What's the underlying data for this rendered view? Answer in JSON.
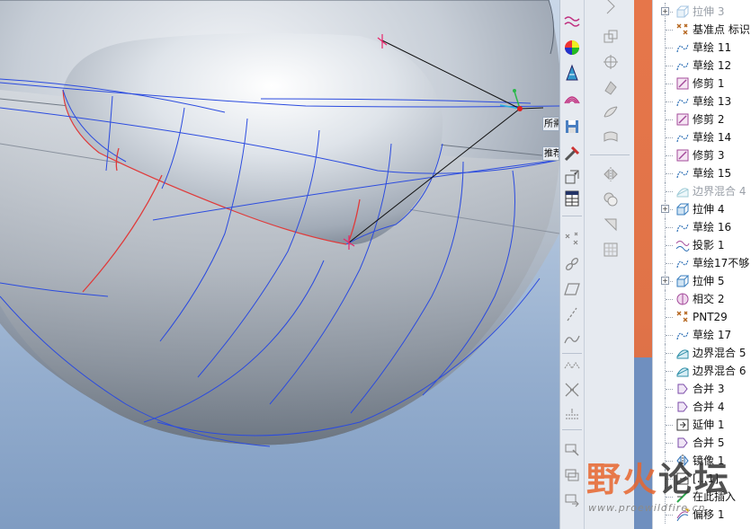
{
  "viewport": {
    "labels": [
      {
        "text": "所需"
      },
      {
        "text": "推荐"
      }
    ],
    "colors": {
      "curve": "#2b4bdf",
      "highlight": "#e03a3a",
      "handle": "#e8266b"
    }
  },
  "tree": {
    "items": [
      {
        "label": "拉伸 3",
        "icon": "extrude-icon",
        "expandable": true,
        "dim": true
      },
      {
        "label": "基准点 标识",
        "icon": "datum-point-icon",
        "expandable": false,
        "dim": false
      },
      {
        "label": "草绘 11",
        "icon": "sketch-icon",
        "expandable": false,
        "dim": false
      },
      {
        "label": "草绘 12",
        "icon": "sketch-icon",
        "expandable": false,
        "dim": false
      },
      {
        "label": "修剪 1",
        "icon": "trim-icon",
        "expandable": false,
        "dim": false
      },
      {
        "label": "草绘 13",
        "icon": "sketch-icon",
        "expandable": false,
        "dim": false
      },
      {
        "label": "修剪 2",
        "icon": "trim-icon",
        "expandable": false,
        "dim": false
      },
      {
        "label": "草绘 14",
        "icon": "sketch-icon",
        "expandable": false,
        "dim": false
      },
      {
        "label": "修剪 3",
        "icon": "trim-icon",
        "expandable": false,
        "dim": false
      },
      {
        "label": "草绘 15",
        "icon": "sketch-icon",
        "expandable": false,
        "dim": false
      },
      {
        "label": "边界混合 4",
        "icon": "boundary-blend-icon",
        "expandable": false,
        "dim": true
      },
      {
        "label": "拉伸 4",
        "icon": "extrude-icon",
        "expandable": true,
        "dim": false
      },
      {
        "label": "草绘 16",
        "icon": "sketch-icon",
        "expandable": false,
        "dim": false
      },
      {
        "label": "投影 1",
        "icon": "projection-icon",
        "expandable": false,
        "dim": false
      },
      {
        "label": "草绘17不够",
        "icon": "sketch-icon",
        "expandable": false,
        "dim": false
      },
      {
        "label": "拉伸 5",
        "icon": "extrude-icon",
        "expandable": true,
        "dim": false
      },
      {
        "label": "相交 2",
        "icon": "intersect-icon",
        "expandable": false,
        "dim": false
      },
      {
        "label": "PNT29",
        "icon": "datum-point-icon",
        "expandable": false,
        "dim": false
      },
      {
        "label": "草绘 17",
        "icon": "sketch-icon",
        "expandable": false,
        "dim": false
      },
      {
        "label": "边界混合 5",
        "icon": "boundary-blend-icon",
        "expandable": false,
        "dim": false
      },
      {
        "label": "边界混合 6",
        "icon": "boundary-blend-icon",
        "expandable": false,
        "dim": false
      },
      {
        "label": "合并 3",
        "icon": "merge-icon",
        "expandable": false,
        "dim": false
      },
      {
        "label": "合并 4",
        "icon": "merge-icon",
        "expandable": false,
        "dim": false
      },
      {
        "label": "延伸 1",
        "icon": "extend-icon",
        "expandable": false,
        "dim": false
      },
      {
        "label": "合并 5",
        "icon": "merge-icon",
        "expandable": false,
        "dim": false
      },
      {
        "label": "镜像 1",
        "icon": "mirror-icon",
        "expandable": false,
        "dim": false
      },
      {
        "label": "[…1]",
        "icon": "group-icon",
        "expandable": false,
        "dim": false
      },
      {
        "label": "在此插入",
        "icon": "insert-here-icon",
        "expandable": false,
        "dim": false
      },
      {
        "label": "偏移 1",
        "icon": "offset-icon",
        "expandable": false,
        "dim": false
      }
    ]
  },
  "watermark": {
    "brand_orange": "野火",
    "brand_dark": "论坛",
    "url": "www.proewildfire.cn"
  }
}
